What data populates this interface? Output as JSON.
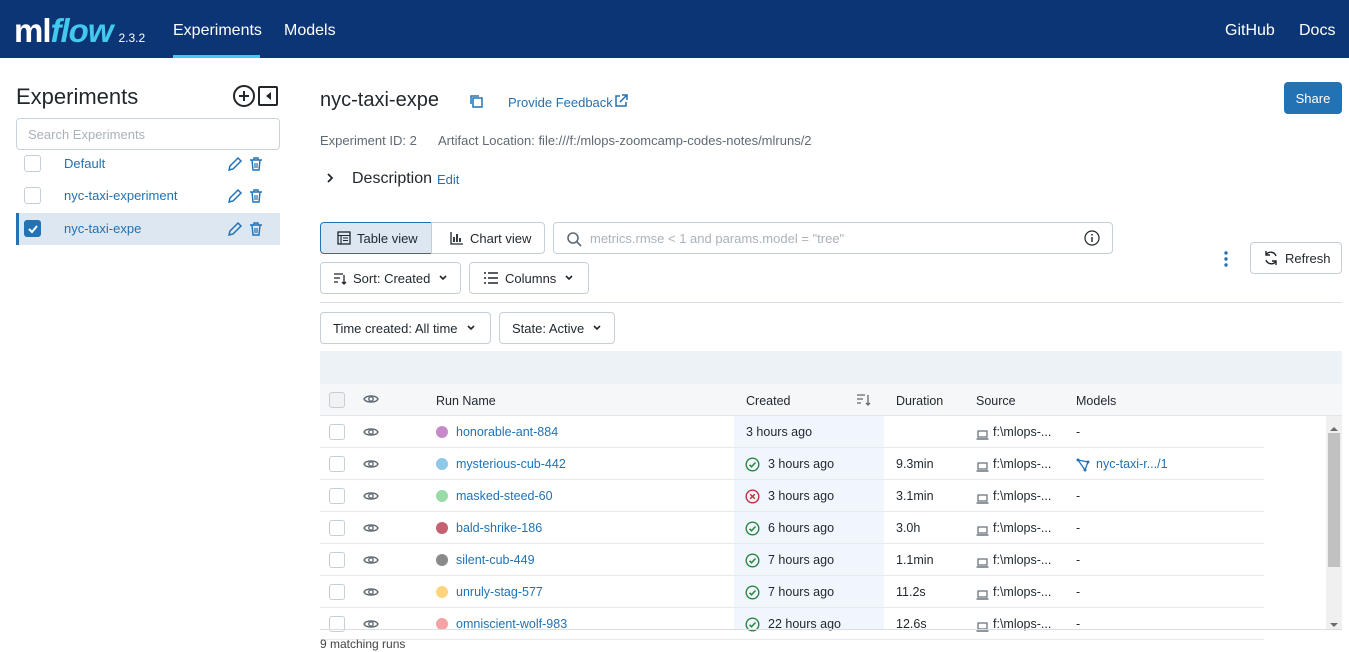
{
  "topbar": {
    "logo_ml": "ml",
    "logo_flow": "flow",
    "version": "2.3.2",
    "nav": [
      "Experiments",
      "Models"
    ],
    "right": [
      "GitHub",
      "Docs"
    ]
  },
  "sidebar": {
    "title": "Experiments",
    "search_placeholder": "Search Experiments",
    "experiments": [
      {
        "name": "Default",
        "checked": false
      },
      {
        "name": "nyc-taxi-experiment",
        "checked": false
      },
      {
        "name": "nyc-taxi-expe",
        "checked": true
      }
    ]
  },
  "header": {
    "title": "nyc-taxi-expe",
    "feedback": "Provide Feedback",
    "share": "Share",
    "experiment_id": "Experiment ID: 2",
    "artifact_location": "Artifact Location: file:///f:/mlops-zoomcamp-codes-notes/mlruns/2",
    "description": "Description",
    "description_edit": "Edit"
  },
  "controls": {
    "table_view": "Table view",
    "chart_view": "Chart view",
    "search_placeholder": "metrics.rmse < 1 and params.model = \"tree\"",
    "sort": "Sort: Created",
    "columns": "Columns",
    "refresh": "Refresh",
    "time_created": "Time created: All time",
    "state": "State: Active"
  },
  "table": {
    "headers": [
      "Run Name",
      "Created",
      "Duration",
      "Source",
      "Models"
    ],
    "rows": [
      {
        "color": "#c68ac9",
        "name": "honorable-ant-884",
        "status": "",
        "created": "3 hours ago",
        "duration": "",
        "source": "f:\\mlops-...",
        "models": "-"
      },
      {
        "color": "#8fc8e8",
        "name": "mysterious-cub-442",
        "status": "success",
        "created": "3 hours ago",
        "duration": "9.3min",
        "source": "f:\\mlops-...",
        "models": "nyc-taxi-r.../1"
      },
      {
        "color": "#99dca8",
        "name": "masked-steed-60",
        "status": "failed",
        "created": "3 hours ago",
        "duration": "3.1min",
        "source": "f:\\mlops-...",
        "models": "-"
      },
      {
        "color": "#c46272",
        "name": "bald-shrike-186",
        "status": "success",
        "created": "6 hours ago",
        "duration": "3.0h",
        "source": "f:\\mlops-...",
        "models": "-"
      },
      {
        "color": "#8a8a8a",
        "name": "silent-cub-449",
        "status": "success",
        "created": "7 hours ago",
        "duration": "1.1min",
        "source": "f:\\mlops-...",
        "models": "-"
      },
      {
        "color": "#ffd47f",
        "name": "unruly-stag-577",
        "status": "success",
        "created": "7 hours ago",
        "duration": "11.2s",
        "source": "f:\\mlops-...",
        "models": "-"
      },
      {
        "color": "#f4a4a4",
        "name": "omniscient-wolf-983",
        "status": "success",
        "created": "22 hours ago",
        "duration": "12.6s",
        "source": "f:\\mlops-...",
        "models": "-"
      }
    ],
    "footer": "9 matching runs"
  },
  "colors": {
    "topbar": "#0b3574",
    "accent": "#43c9ed",
    "link": "#2272b4",
    "success": "#2e8540",
    "failed": "#c82a34"
  }
}
